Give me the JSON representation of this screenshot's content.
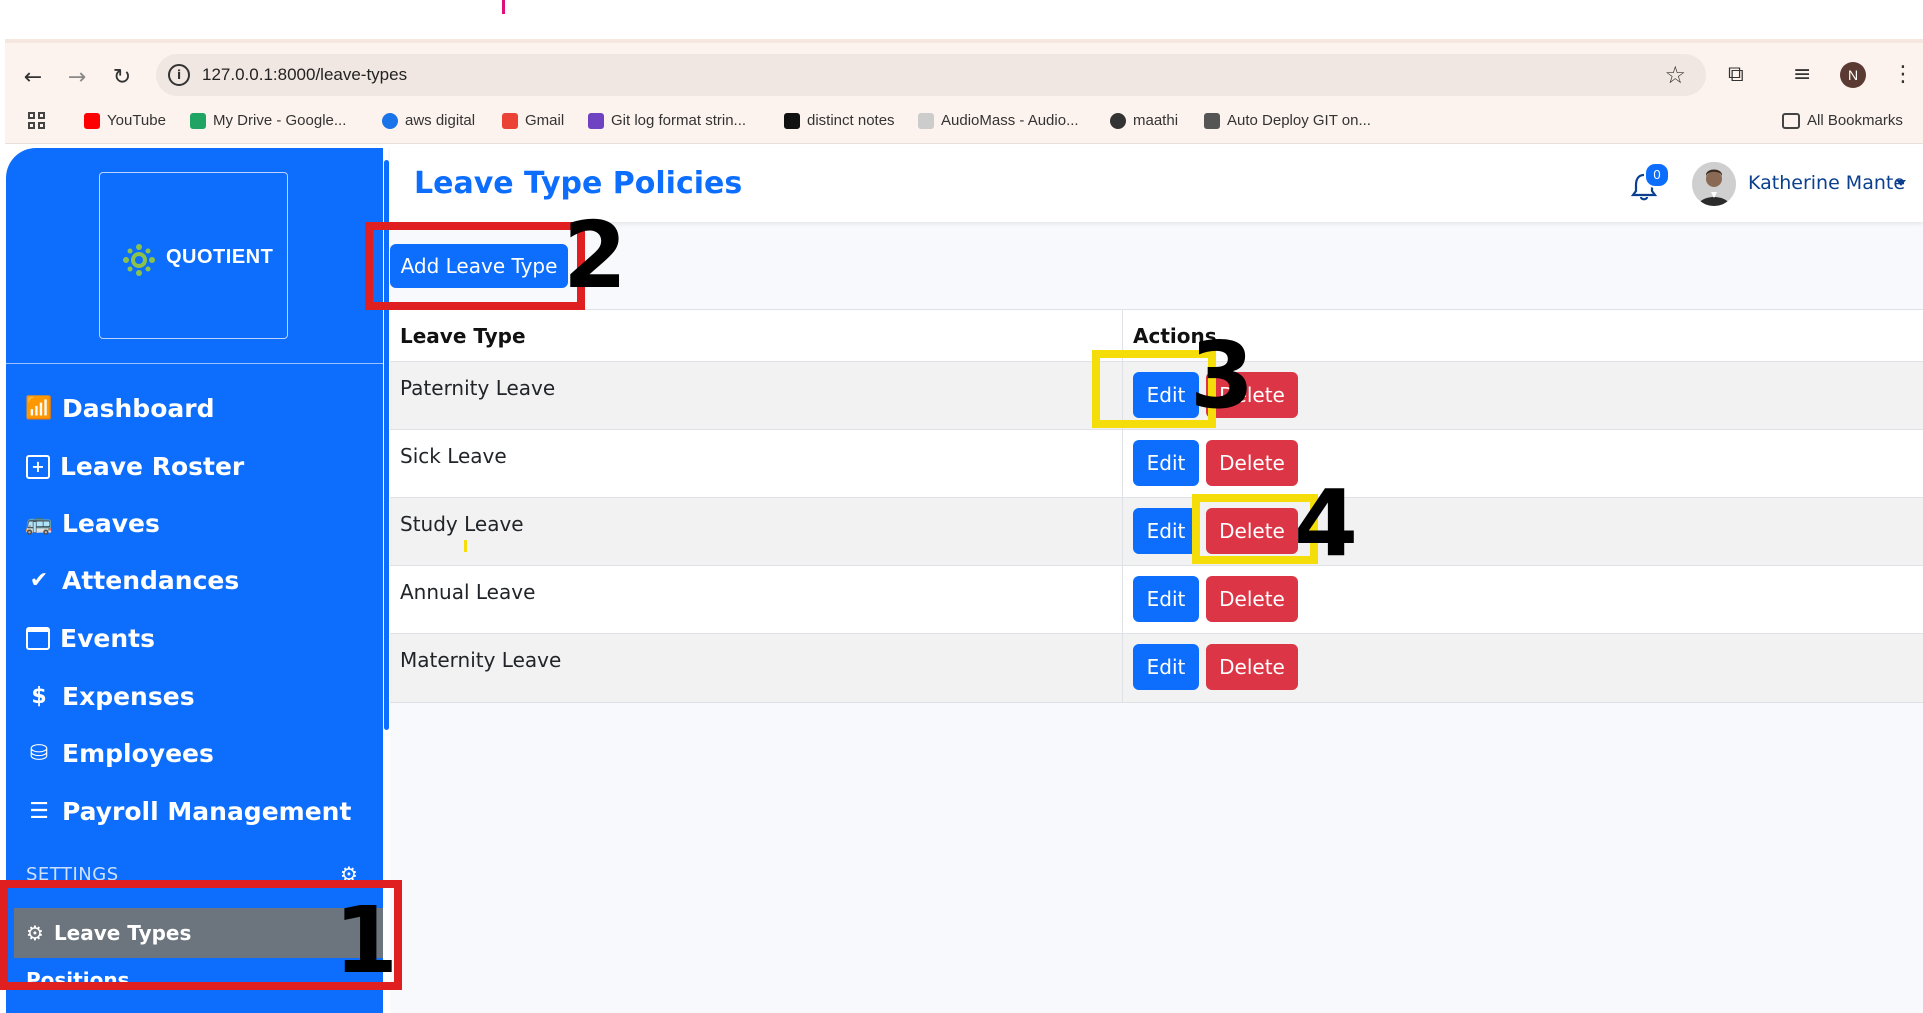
{
  "browser": {
    "url": "127.0.0.1:8000/leave-types",
    "profile_initial": "N",
    "bookmarks": [
      {
        "label": "YouTube",
        "color": "#ff0000"
      },
      {
        "label": "My Drive - Google...",
        "color": "#1fa463"
      },
      {
        "label": "aws digital",
        "color": "#1a73e8"
      },
      {
        "label": "Gmail",
        "color": "#ea4335"
      },
      {
        "label": "Git log format strin...",
        "color": "#6f42c1"
      },
      {
        "label": "distinct notes",
        "color": "#111111"
      },
      {
        "label": "AudioMass - Audio...",
        "color": "#999999"
      },
      {
        "label": "maathi",
        "color": "#333333"
      },
      {
        "label": "Auto Deploy GIT on...",
        "color": "#555555"
      }
    ],
    "all_bookmarks": "All Bookmarks"
  },
  "sidebar": {
    "logo_text": "QUOTIENT",
    "items": [
      {
        "label": "Dashboard",
        "icon": "bar-chart-icon"
      },
      {
        "label": "Leave Roster",
        "icon": "calendar-plus-icon"
      },
      {
        "label": "Leaves",
        "icon": "bus-icon"
      },
      {
        "label": "Attendances",
        "icon": "double-check-icon"
      },
      {
        "label": "Events",
        "icon": "calendar-icon"
      },
      {
        "label": "Expenses",
        "icon": "dollar-icon"
      },
      {
        "label": "Employees",
        "icon": "database-user-icon"
      },
      {
        "label": "Payroll Management",
        "icon": "list-icon"
      }
    ],
    "settings_label": "SETTINGS",
    "active_item": "Leave Types",
    "next_item": "Positions"
  },
  "header": {
    "title": "Leave Type Policies",
    "notification_count": "0",
    "user_name": "Katherine Mante"
  },
  "main": {
    "add_button": "Add Leave Type",
    "columns": [
      "Leave Type",
      "Actions"
    ],
    "rows": [
      {
        "name": "Paternity Leave"
      },
      {
        "name": "Sick Leave"
      },
      {
        "name": "Study Leave"
      },
      {
        "name": "Annual Leave"
      },
      {
        "name": "Maternity Leave"
      }
    ],
    "edit_label": "Edit",
    "delete_label": "Delete"
  },
  "annotations": {
    "numbers": [
      "1",
      "2",
      "3",
      "4"
    ],
    "colors": {
      "red": "#e02020",
      "yellow": "#f5dd0a"
    }
  },
  "colors": {
    "primary": "#0d6efd",
    "danger": "#dc3545",
    "active": "#6c757d"
  }
}
